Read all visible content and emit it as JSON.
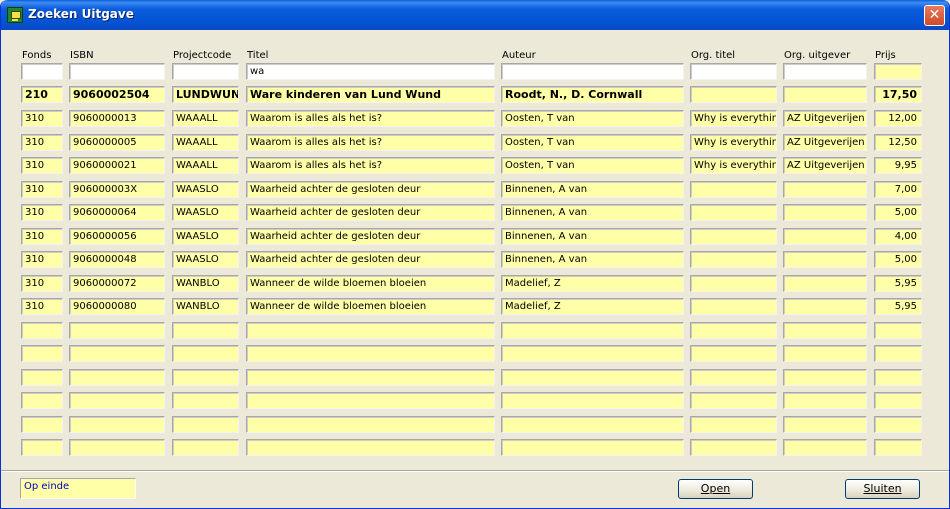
{
  "window": {
    "title": "Zoeken Uitgave",
    "close_label": "✕"
  },
  "columns": [
    "Fonds",
    "ISBN",
    "Projectcode",
    "Titel",
    "Auteur",
    "Org. titel",
    "Org. uitgever",
    "Prijs"
  ],
  "filters": {
    "fonds": "",
    "isbn": "",
    "projectcode": "",
    "titel": "wa",
    "auteur": "",
    "org_titel": "",
    "org_uitgever": "",
    "prijs": ""
  },
  "selected": {
    "fonds": "210",
    "isbn": "9060002504",
    "projectcode": "LUNDWUND",
    "titel": "Ware kinderen van Lund Wund",
    "auteur": "Roodt, N., D. Cornwall",
    "org_titel": "",
    "org_uitgever": "",
    "prijs": "17,50"
  },
  "rows": [
    {
      "fonds": "310",
      "isbn": "9060000013",
      "projectcode": "WAAALL",
      "titel": "Waarom is alles als het is?",
      "auteur": "Oosten, T van",
      "org_titel": "Why is everything",
      "org_uitgever": "AZ Uitgeverijen",
      "prijs": "12,00"
    },
    {
      "fonds": "310",
      "isbn": "9060000005",
      "projectcode": "WAAALL",
      "titel": "Waarom is alles als het is?",
      "auteur": "Oosten, T van",
      "org_titel": "Why is everything",
      "org_uitgever": "AZ Uitgeverijen",
      "prijs": "12,50"
    },
    {
      "fonds": "310",
      "isbn": "9060000021",
      "projectcode": "WAAALL",
      "titel": "Waarom is alles als het is?",
      "auteur": "Oosten, T van",
      "org_titel": "Why is everything",
      "org_uitgever": "AZ Uitgeverijen",
      "prijs": "9,95"
    },
    {
      "fonds": "310",
      "isbn": "906000003X",
      "projectcode": "WAASLO",
      "titel": "Waarheid achter de gesloten deur",
      "auteur": "Binnenen, A van",
      "org_titel": "",
      "org_uitgever": "",
      "prijs": "7,00"
    },
    {
      "fonds": "310",
      "isbn": "9060000064",
      "projectcode": "WAASLO",
      "titel": "Waarheid achter de gesloten deur",
      "auteur": "Binnenen, A van",
      "org_titel": "",
      "org_uitgever": "",
      "prijs": "5,00"
    },
    {
      "fonds": "310",
      "isbn": "9060000056",
      "projectcode": "WAASLO",
      "titel": "Waarheid achter de gesloten deur",
      "auteur": "Binnenen, A van",
      "org_titel": "",
      "org_uitgever": "",
      "prijs": "4,00"
    },
    {
      "fonds": "310",
      "isbn": "9060000048",
      "projectcode": "WAASLO",
      "titel": "Waarheid achter de gesloten deur",
      "auteur": "Binnenen, A van",
      "org_titel": "",
      "org_uitgever": "",
      "prijs": "5,00"
    },
    {
      "fonds": "310",
      "isbn": "9060000072",
      "projectcode": "WANBLO",
      "titel": "Wanneer de wilde bloemen bloeien",
      "auteur": "Madelief, Z",
      "org_titel": "",
      "org_uitgever": "",
      "prijs": "5,95"
    },
    {
      "fonds": "310",
      "isbn": "9060000080",
      "projectcode": "WANBLO",
      "titel": "Wanneer de wilde bloemen bloeien",
      "auteur": "Madelief, Z",
      "org_titel": "",
      "org_uitgever": "",
      "prijs": "5,95"
    },
    {
      "fonds": "",
      "isbn": "",
      "projectcode": "",
      "titel": "",
      "auteur": "",
      "org_titel": "",
      "org_uitgever": "",
      "prijs": ""
    },
    {
      "fonds": "",
      "isbn": "",
      "projectcode": "",
      "titel": "",
      "auteur": "",
      "org_titel": "",
      "org_uitgever": "",
      "prijs": ""
    },
    {
      "fonds": "",
      "isbn": "",
      "projectcode": "",
      "titel": "",
      "auteur": "",
      "org_titel": "",
      "org_uitgever": "",
      "prijs": ""
    },
    {
      "fonds": "",
      "isbn": "",
      "projectcode": "",
      "titel": "",
      "auteur": "",
      "org_titel": "",
      "org_uitgever": "",
      "prijs": ""
    },
    {
      "fonds": "",
      "isbn": "",
      "projectcode": "",
      "titel": "",
      "auteur": "",
      "org_titel": "",
      "org_uitgever": "",
      "prijs": ""
    },
    {
      "fonds": "",
      "isbn": "",
      "projectcode": "",
      "titel": "",
      "auteur": "",
      "org_titel": "",
      "org_uitgever": "",
      "prijs": ""
    }
  ],
  "status_text": "Op einde",
  "buttons": {
    "open": "Open",
    "sluiten": "Sluiten"
  },
  "colors": {
    "field_bg": "#ffffa8",
    "titlebar": "#0a5cdc",
    "status_text": "#0000c0"
  }
}
